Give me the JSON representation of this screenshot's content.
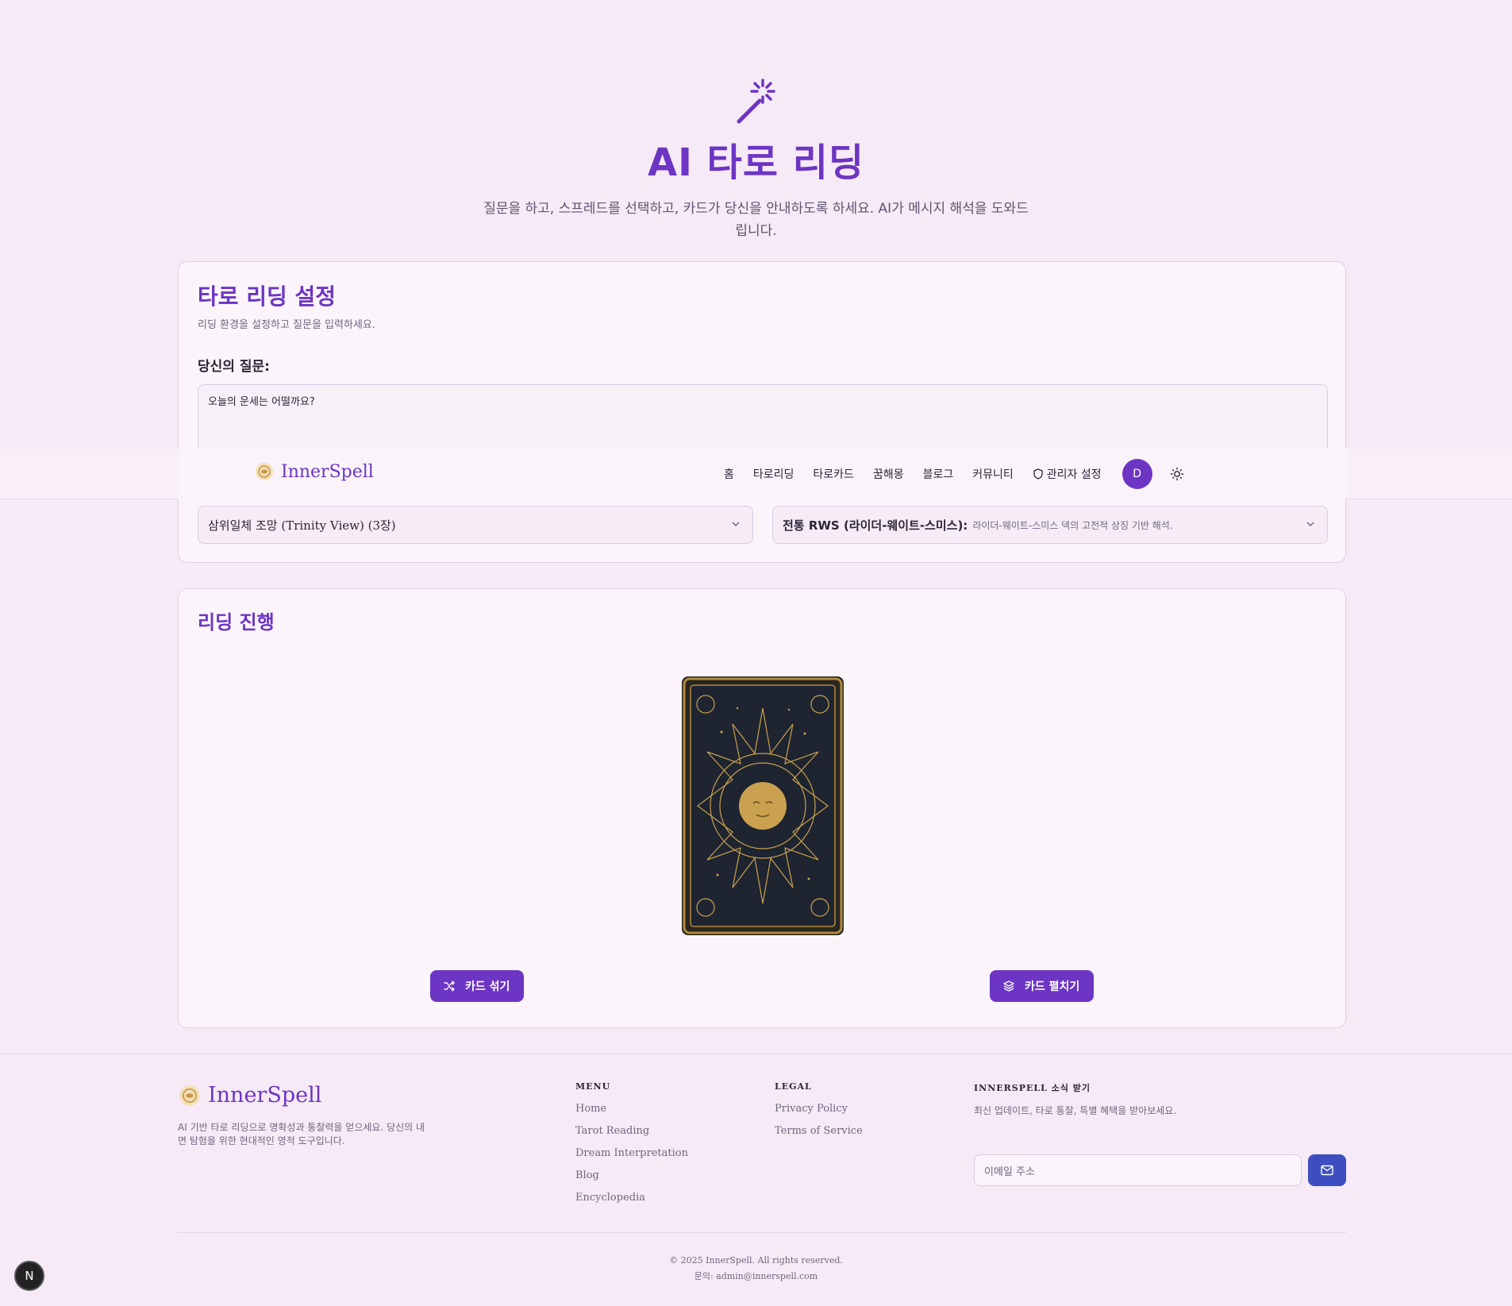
{
  "hero": {
    "icon": "magic-wand-icon",
    "title": "AI 타로 리딩",
    "description": "질문을 하고, 스프레드를 선택하고, 카드가 당신을 안내하도록 하세요. AI가 메시지 해석을 도와드립니다."
  },
  "settings": {
    "title": "타로 리딩 설정",
    "subtitle": "리딩 환경을 설정하고 질문을 입력하세요.",
    "question_label": "당신의 질문:",
    "question_value": "오늘의 운세는 어떨까요?",
    "spread_value": "삼위일체 조망 (Trinity View) (3장)",
    "style_value": "전통 RWS (라이더-웨이트-스미스):",
    "style_desc": "라이더-웨이트-스미스 덱의 고전적 상징 기반 해석."
  },
  "nav": {
    "brand": "InnerSpell",
    "links": [
      "홈",
      "타로리딩",
      "타로카드",
      "꿈해몽",
      "블로그",
      "커뮤니티"
    ],
    "admin_label": "관리자 설정",
    "avatar_initial": "D"
  },
  "reading": {
    "title": "리딩 진행",
    "shuffle_label": "카드 섞기",
    "spread_label": "카드 펼치기"
  },
  "footer": {
    "brand": "InnerSpell",
    "description": "AI 기반 타로 리딩으로 명확성과 통찰력을 얻으세요. 당신의 내면 탐험을 위한 현대적인 영적 도구입니다.",
    "menu_title": "MENU",
    "menu": [
      "Home",
      "Tarot Reading",
      "Dream Interpretation",
      "Blog",
      "Encyclopedia"
    ],
    "legal_title": "LEGAL",
    "legal": [
      "Privacy Policy",
      "Terms of Service"
    ],
    "news_title": "INNERSPELL 소식 받기",
    "news_desc": "최신 업데이트, 타로 통찰, 특별 혜택을 받아보세요.",
    "email_placeholder": "이메일 주소",
    "copyright": "© 2025 InnerSpell. All rights reserved.",
    "contact": "문의: admin@innerspell.com"
  },
  "dev_badge": "N",
  "colors": {
    "accent": "#6d35c3",
    "background": "#f6eaf6",
    "email_button": "#3d4fc0"
  }
}
